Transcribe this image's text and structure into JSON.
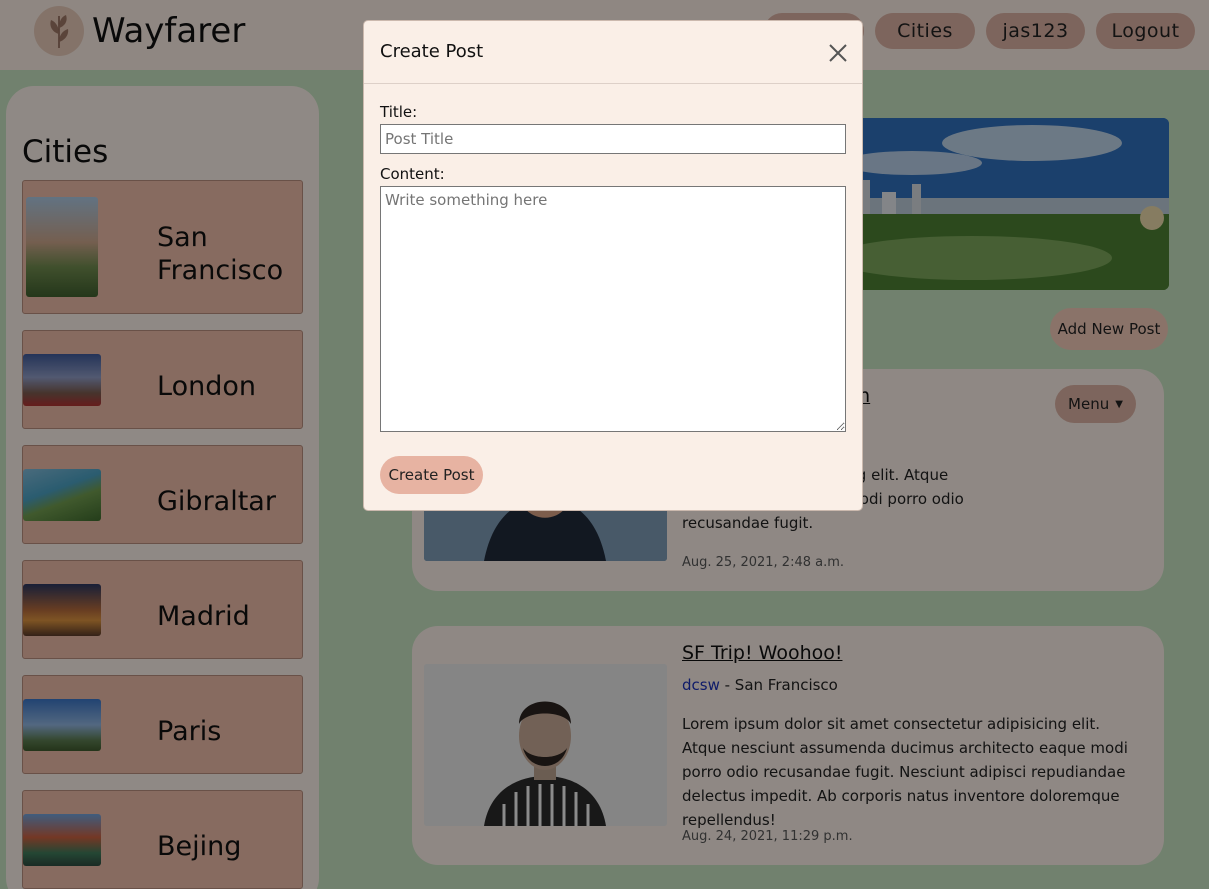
{
  "navbar": {
    "brand": "Wayfarer",
    "links": [
      {
        "label": ""
      },
      {
        "label": "Cities"
      },
      {
        "label": "jas123"
      },
      {
        "label": "Logout"
      }
    ]
  },
  "sidebar": {
    "title": "Cities",
    "cities": [
      {
        "name": "San Francisco"
      },
      {
        "name": "London"
      },
      {
        "name": "Gibraltar"
      },
      {
        "name": "Madrid"
      },
      {
        "name": "Paris"
      },
      {
        "name": "Bejing"
      }
    ]
  },
  "main": {
    "add_post_label": "Add New Post",
    "posts": [
      {
        "title_fragment": "am",
        "menu_label": "Menu",
        "body": "t consectetur adipisicing elit. Atque\nnus architecto eaque modi porro odio\nrecusandae fugit.",
        "date": "Aug. 25, 2021, 2:48 a.m."
      },
      {
        "title": "SF Trip! Woohoo!",
        "user": "dcsw",
        "city": " - San Francisco",
        "body": "Lorem ipsum dolor sit amet consectetur adipisicing elit. Atque nesciunt assumenda ducimus architecto eaque modi porro odio recusandae fugit. Nesciunt adipisci repudiandae delectus impedit. Ab corporis natus inventore doloremque repellendus!",
        "date": "Aug. 24, 2021, 11:29 p.m."
      }
    ]
  },
  "modal": {
    "title": "Create Post",
    "title_label": "Title:",
    "title_placeholder": "Post Title",
    "content_label": "Content:",
    "content_placeholder": "Write something here",
    "submit_label": "Create Post"
  }
}
